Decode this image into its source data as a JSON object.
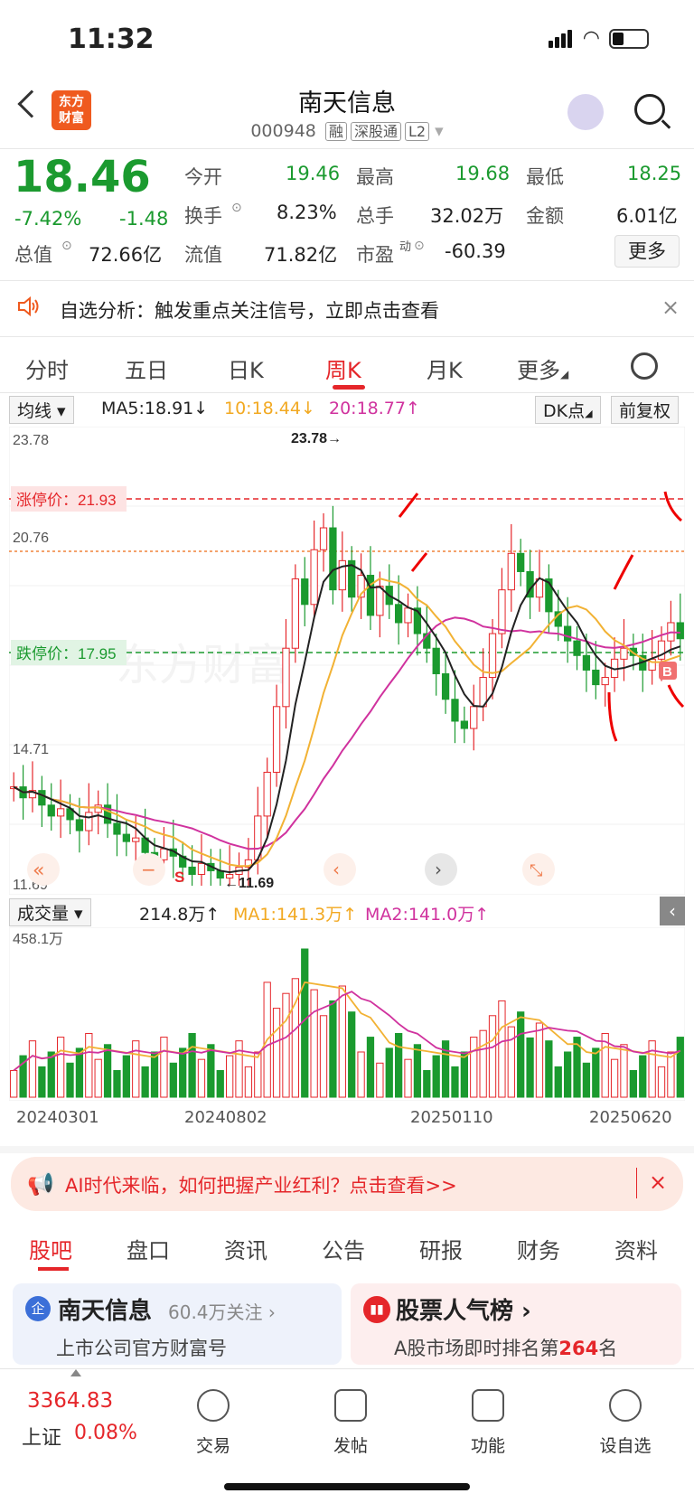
{
  "status_bar": {
    "time": "11:32"
  },
  "header": {
    "logo_text": "东方\n财富",
    "title": "南天信息",
    "code": "000948",
    "tags": [
      "融",
      "深股通",
      "L2"
    ]
  },
  "quote": {
    "price": "18.46",
    "change_pct": "-7.42%",
    "change": "-1.48",
    "open_label": "今开",
    "open": "19.46",
    "high_label": "最高",
    "high": "19.68",
    "low_label": "最低",
    "low": "18.25",
    "turnover_label": "换手",
    "turnover": "8.23%",
    "volume_label": "总手",
    "volume": "32.02万",
    "amount_label": "金额",
    "amount": "6.01亿",
    "mktcap_label": "总值",
    "mktcap": "72.66亿",
    "float_label": "流值",
    "float": "71.82亿",
    "pe_label": "市盈",
    "pe_sup": "动",
    "pe": "-60.39",
    "more_label": "更多"
  },
  "notice": {
    "text": "自选分析：触发重点关注信号，立即点击查看",
    "close": "×"
  },
  "chart_tabs": [
    "分时",
    "五日",
    "日K",
    "周K",
    "月K",
    "更多"
  ],
  "active_chart_tab": "周K",
  "ma_bar": {
    "selector": "均线",
    "ma5": "MA5:18.91↓",
    "ma10": "10:18.44↓",
    "ma20": "20:18.77↑",
    "dk": "DK点",
    "adjust": "前复权"
  },
  "price_chart": {
    "y_high_label": "23.78",
    "y_mid_label": "20.76",
    "y_low1_label": "14.71",
    "y_low_label": "11.69",
    "limit_up_label": "涨停价：21.93",
    "limit_down_label": "跌停价：17.95",
    "max_marker": "23.78→",
    "min_marker": "←11.69",
    "watermark": "东方财富",
    "s_marker": "S",
    "b_marker": "B"
  },
  "chart_data": {
    "type": "candlestick",
    "period": "weekly",
    "ylim": [
      11.69,
      23.78
    ],
    "high": 23.78,
    "low": 11.69,
    "limit_up": 21.93,
    "limit_down": 17.95,
    "last": 18.46,
    "volume_max": "458.1万",
    "x_ticks": [
      "20240301",
      "20240802",
      "20250110",
      "20250620"
    ]
  },
  "volume_bar": {
    "selector": "成交量",
    "vol": "214.8万↑",
    "ma1": "MA1:141.3万↑",
    "ma2": "MA2:141.0万↑",
    "max_label": "458.1万"
  },
  "dates": [
    "20240301",
    "20240802",
    "20250110",
    "20250620"
  ],
  "ai_banner": {
    "text": "AI时代来临，如何把握产业红利？点击查看>>",
    "close": "×"
  },
  "info_tabs": [
    "股吧",
    "盘口",
    "资讯",
    "公告",
    "研报",
    "财务",
    "资料"
  ],
  "cards": {
    "left_title": "南天信息",
    "left_follow": "60.4万关注 ›",
    "left_sub": "上市公司官方财富号",
    "right_title": "股票人气榜 ›",
    "right_sub_prefix": "A股市场即时排名第",
    "right_rank": "264",
    "right_sub_suffix": "名"
  },
  "bottom_nav": {
    "index_value": "3364.83",
    "index_name": "上证",
    "index_pct": "0.08%",
    "items": [
      "交易",
      "发帖",
      "功能",
      "设自选"
    ]
  }
}
